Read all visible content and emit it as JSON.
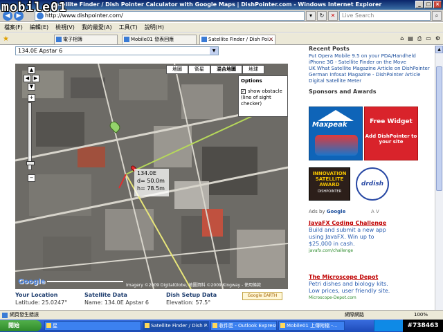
{
  "window": {
    "title": "Satellite Finder / Dish Pointer Calculator with Google Maps | DishPointer.com - Windows Internet Explorer"
  },
  "watermark_logo": "mobile01",
  "address": {
    "url": "http://www.dishpointer.com/"
  },
  "search": {
    "placeholder": "Live Search"
  },
  "menu": [
    "檔案(F)",
    "編輯(E)",
    "檢視(V)",
    "我的最愛(A)",
    "工具(T)",
    "說明(H)"
  ],
  "tabs": [
    {
      "label": "電子相簿"
    },
    {
      "label": "Mobile01 發表回應"
    },
    {
      "label": "Satellite Finder / Dish Poi..."
    }
  ],
  "page": {
    "satellite_select": "134.0E Apstar 6",
    "map_types": [
      "地圖",
      "衛星",
      "混合地圖",
      "地球"
    ],
    "options": {
      "title": "Options",
      "checkbox_label": "show obstacle (line of sight checker)"
    },
    "info_box": {
      "sat": "134.0E",
      "d": "d= 50.0m",
      "h": "h= 78.5m"
    },
    "copyright": "Imagery ©2009 DigitalGlobe, 地圖資料 ©2009 Kingway - 使用條款",
    "google_logo": "Google",
    "your_location": {
      "heading": "Your Location",
      "value": "Latitude: 25.0247°"
    },
    "satellite_data": {
      "heading": "Satellite Data",
      "value": "Name: 134.0E Apstar 6"
    },
    "dish_setup": {
      "heading": "Dish Setup Data",
      "value": "Elevation: 57.5°"
    },
    "earth_button": "Google EARTH"
  },
  "sidebar": {
    "recent_posts_heading": "Recent Posts",
    "posts": [
      "Put Opera Mobile 9.5 on your PDA/Handheld",
      "iPhone 3G - Satellite Finder on the Move",
      "UK What Satellite Magazine Article on DishPointer",
      "German Infosat Magazine - DishPointer Article",
      "Digital Satellite Meter"
    ],
    "sponsors_heading": "Sponsors and Awards",
    "ad1_brand": "Maxpeak",
    "ad2_title": "Free Widget",
    "ad2_sub": "Add DishPointer to your site",
    "award1_title": "INNOVATION SATELLITE AWARD",
    "award1_sub": "DISHPOINTER",
    "award2_title": "drdish",
    "ads_by": "Ads by",
    "ads_by_brand": "Google",
    "ads_nav": "A V",
    "ads": [
      {
        "title": "JavaFX Coding Challenge",
        "body": "Build and submit a new app using JavaFX. Win up to $25,000 in cash.",
        "url": "javafx.com/challenge"
      },
      {
        "title": "The Microscope Depot",
        "body": "Petri dishes and biology kits. Low prices, user friendly site.",
        "url": "Microscope-Depot.com"
      }
    ]
  },
  "status": {
    "left": "網頁發生錯誤",
    "right": "網際網路",
    "zoom": "100%"
  },
  "taskbar": {
    "start": "開始",
    "tasks": [
      "星",
      "Satellite Finder / Dish P...",
      "收件匣 - Outlook Express",
      "Mobile01 上傳附檔 -..."
    ],
    "post_id": "#738463"
  },
  "colors": {
    "titlebar": "#0a246a",
    "link": "#1a4d9c",
    "ad_title": "#c00000"
  }
}
